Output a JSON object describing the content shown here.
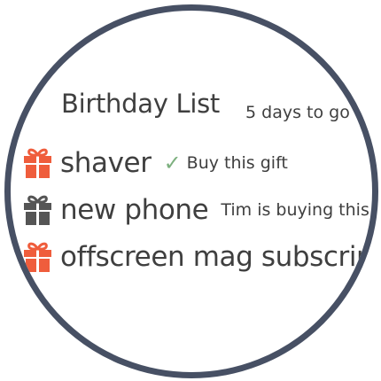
{
  "header": {
    "title": "Birthday List",
    "countdown": "5 days to go"
  },
  "gifts": [
    {
      "name": "shaver",
      "status_icon": "checkmark",
      "note": "Buy this gift",
      "icon": "gift-icon",
      "icon_color": "#ef5d3c"
    },
    {
      "name": "new phone",
      "note": "Tim is buying this",
      "icon": "gift-icon",
      "icon_color": "#555555"
    },
    {
      "name": "offscreen mag subscrip",
      "icon": "gift-icon",
      "icon_color": "#ef5d3c"
    }
  ],
  "colors": {
    "frame": "#475064",
    "text": "#3f3f3f",
    "gift_available": "#ef5d3c",
    "gift_taken": "#555555",
    "check": "#7db07f"
  }
}
